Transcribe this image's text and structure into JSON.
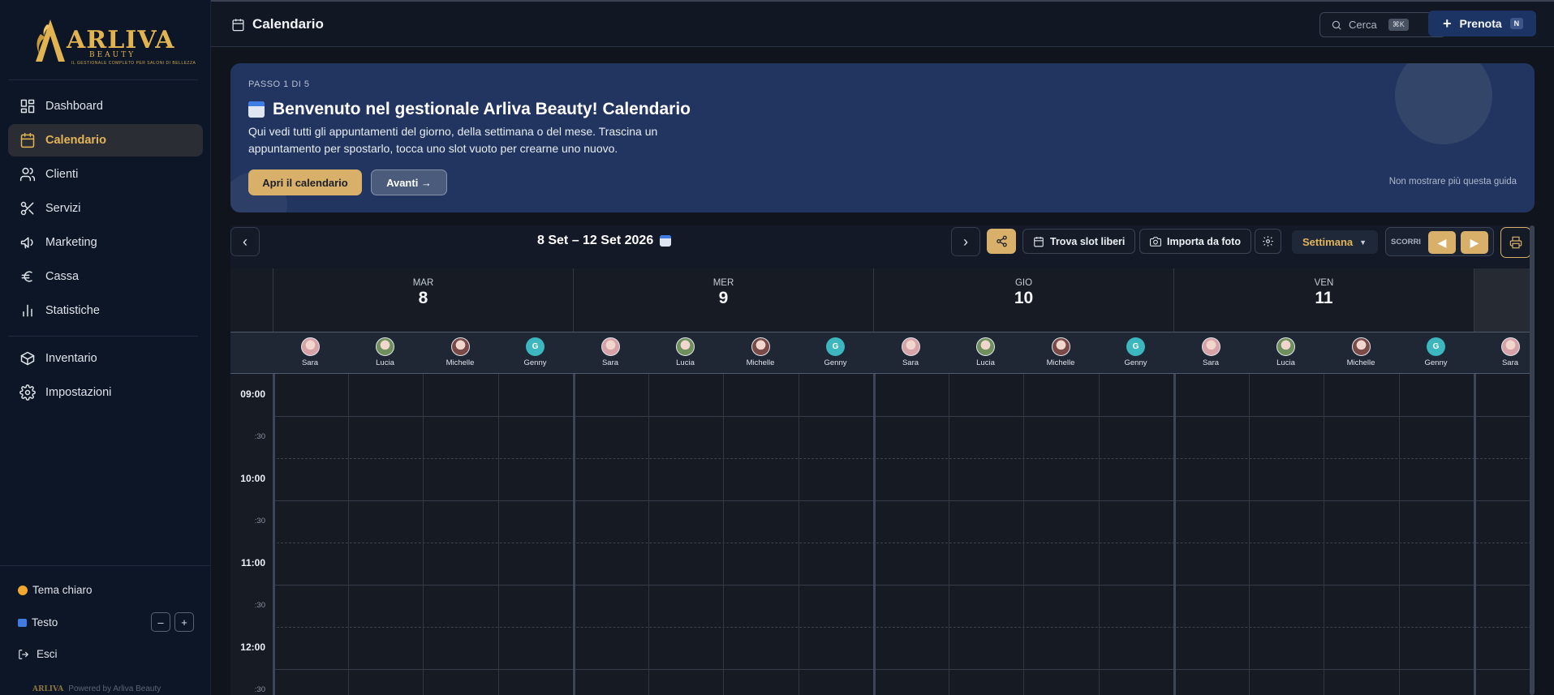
{
  "app": {
    "logo_text": "ARLIVA",
    "logo_sub": "BEAUTY",
    "logo_tagline": "IL GESTIONALE COMPLETO PER SALONI DI BELLEZZA"
  },
  "sidebar": {
    "items": [
      {
        "label": "Dashboard",
        "icon": "dashboard-icon"
      },
      {
        "label": "Calendario",
        "icon": "calendar-icon",
        "active": true
      },
      {
        "label": "Clienti",
        "icon": "users-icon"
      },
      {
        "label": "Servizi",
        "icon": "scissors-icon"
      },
      {
        "label": "Marketing",
        "icon": "megaphone-icon"
      },
      {
        "label": "Cassa",
        "icon": "euro-icon"
      },
      {
        "label": "Statistiche",
        "icon": "bar-chart-icon"
      },
      {
        "label": "Inventario",
        "icon": "box-icon"
      },
      {
        "label": "Impostazioni",
        "icon": "gear-icon"
      }
    ],
    "theme_label": "Tema chiaro",
    "text_label": "Testo",
    "text_decrease": "–",
    "text_increase": "+",
    "logout_label": "Esci",
    "powered_logo": "ARLIVA",
    "powered_by": "Powered by Arliva Beauty"
  },
  "topbar": {
    "title": "Calendario",
    "search_label": "Cerca",
    "search_shortcut": "⌘K",
    "book_label": "Prenota",
    "book_shortcut": "N"
  },
  "guide": {
    "step": "PASSO 1 DI 5",
    "title": "Benvenuto nel gestionale Arliva Beauty! Calendario",
    "text": "Qui vedi tutti gli appuntamenti del giorno, della settimana o del mese. Trascina un appuntamento per spostarlo, tocca uno slot vuoto per crearne uno nuovo.",
    "primary_button": "Apri il calendario",
    "next_button": "Avanti →",
    "dismiss": "Non mostrare più questa guida"
  },
  "toolbar": {
    "prev": "‹",
    "next": "›",
    "week_range": "8 Set – 12 Set 2026",
    "find_slots": "Trova slot liberi",
    "import_photo": "Importa da foto",
    "view": "Settimana",
    "scroll_label": "SCORRI",
    "scroll_left": "◀",
    "scroll_right": "▶"
  },
  "calendar": {
    "days": [
      {
        "dow": "MAR",
        "num": "8"
      },
      {
        "dow": "MER",
        "num": "9"
      },
      {
        "dow": "GIO",
        "num": "10"
      },
      {
        "dow": "VEN",
        "num": "11"
      }
    ],
    "staff": [
      {
        "name": "Sara",
        "color": "#d7a2a8"
      },
      {
        "name": "Lucia",
        "color": "#6f8f5c"
      },
      {
        "name": "Michelle",
        "color": "#7a4a48"
      },
      {
        "name": "Genny",
        "initial": "G",
        "color": "#3cb6bf"
      }
    ],
    "partial_staff": "Sara",
    "times": [
      "09:00",
      ":30",
      "10:00",
      ":30",
      "11:00",
      ":30",
      "12:00",
      ":30"
    ]
  },
  "colors": {
    "accent": "#d8b06a",
    "active_text": "#e4b458",
    "banner": "#223560",
    "sidebar": "#0d1626"
  }
}
